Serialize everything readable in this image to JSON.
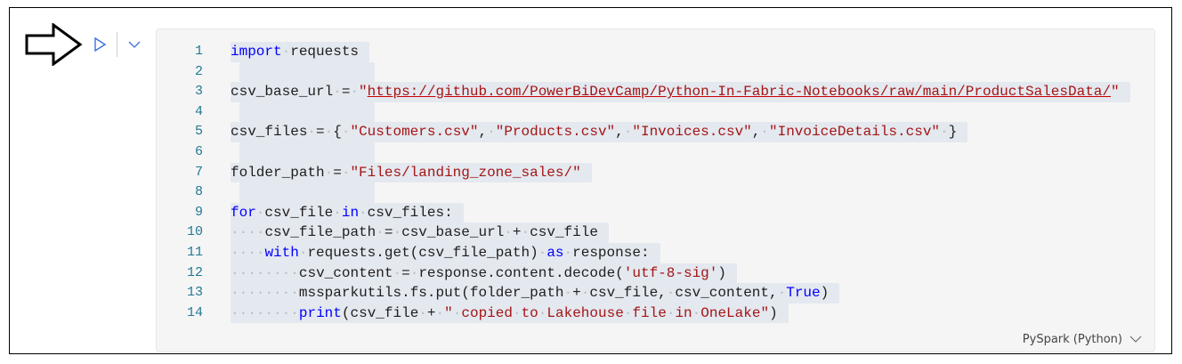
{
  "cell": {
    "language_label": "PySpark (Python)",
    "lines": [
      [
        [
          "k",
          "import"
        ],
        [
          "t",
          " requests"
        ]
      ],
      [],
      [
        [
          "t",
          "csv_base_url = "
        ],
        [
          "s",
          "\""
        ],
        [
          "u",
          "https://github.com/PowerBiDevCamp/Python-In-Fabric-Notebooks/raw/main/ProductSalesData/"
        ],
        [
          "s",
          "\""
        ]
      ],
      [],
      [
        [
          "t",
          "csv_files = { "
        ],
        [
          "s",
          "\"Customers.csv\""
        ],
        [
          "t",
          ", "
        ],
        [
          "s",
          "\"Products.csv\""
        ],
        [
          "t",
          ", "
        ],
        [
          "s",
          "\"Invoices.csv\""
        ],
        [
          "t",
          ", "
        ],
        [
          "s",
          "\"InvoiceDetails.csv\""
        ],
        [
          "t",
          " }"
        ]
      ],
      [],
      [
        [
          "t",
          "folder_path = "
        ],
        [
          "s",
          "\"Files/landing_zone_sales/\""
        ]
      ],
      [],
      [
        [
          "k",
          "for"
        ],
        [
          "t",
          " csv_file "
        ],
        [
          "k",
          "in"
        ],
        [
          "t",
          " csv_files:"
        ]
      ],
      [
        [
          "t",
          "    csv_file_path = csv_base_url + csv_file"
        ]
      ],
      [
        [
          "t",
          "    "
        ],
        [
          "k",
          "with"
        ],
        [
          "t",
          " requests.get(csv_file_path) "
        ],
        [
          "k",
          "as"
        ],
        [
          "t",
          " response:"
        ]
      ],
      [
        [
          "t",
          "        csv_content = response.content.decode("
        ],
        [
          "s",
          "'utf-8-sig'"
        ],
        [
          "t",
          ")"
        ]
      ],
      [
        [
          "t",
          "        mssparkutils.fs.put(folder_path + csv_file, csv_content, "
        ],
        [
          "k",
          "True"
        ],
        [
          "t",
          ")"
        ]
      ],
      [
        [
          "t",
          "        "
        ],
        [
          "k",
          "print"
        ],
        [
          "t",
          "(csv_file + "
        ],
        [
          "s",
          "\" copied to Lakehouse file in OneLake\""
        ],
        [
          "t",
          ")"
        ]
      ]
    ]
  }
}
